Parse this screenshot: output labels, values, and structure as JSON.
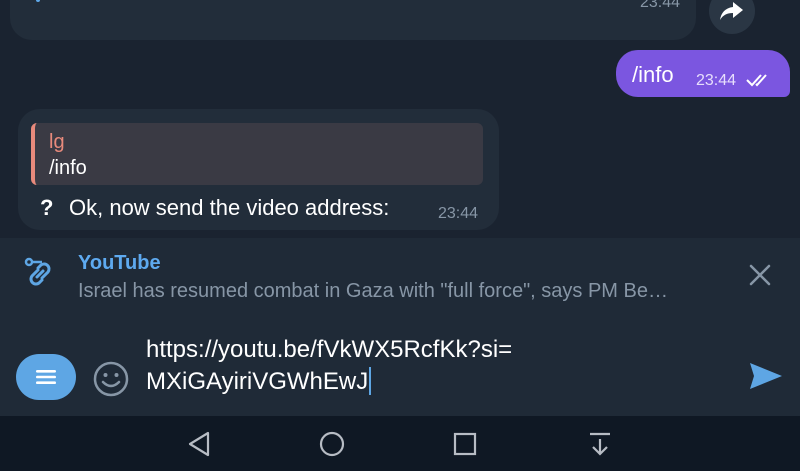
{
  "chat": {
    "top_message": {
      "time": "23:44"
    },
    "outgoing": {
      "text": "/info",
      "time": "23:44"
    },
    "incoming": {
      "quote_name": "lg",
      "quote_text": "/info",
      "icon_text": "?",
      "text": "Ok, now send the video address:",
      "time": "23:44"
    }
  },
  "preview": {
    "title": "YouTube",
    "description": "Israel has resumed combat in Gaza with \"full force\", says PM Be…"
  },
  "composer": {
    "line1": "https://youtu.be/fVkWX5RcfKk?si=",
    "line2": "MXiGAyiriVGWhEwJ"
  },
  "colors": {
    "accent": "#5ea6e4",
    "outgoing_bubble": "#7b56e0",
    "quote_name": "#e88a7c",
    "background": "#1a2330"
  },
  "icons": {
    "share": "share-arrow-icon",
    "link": "link-icon",
    "close": "close-icon",
    "menu": "menu-icon",
    "emoji": "emoji-icon",
    "send": "send-icon",
    "nav_back": "back-triangle-icon",
    "nav_home": "home-circle-icon",
    "nav_recent": "recent-square-icon",
    "nav_notifications": "notification-pulldown-icon"
  }
}
